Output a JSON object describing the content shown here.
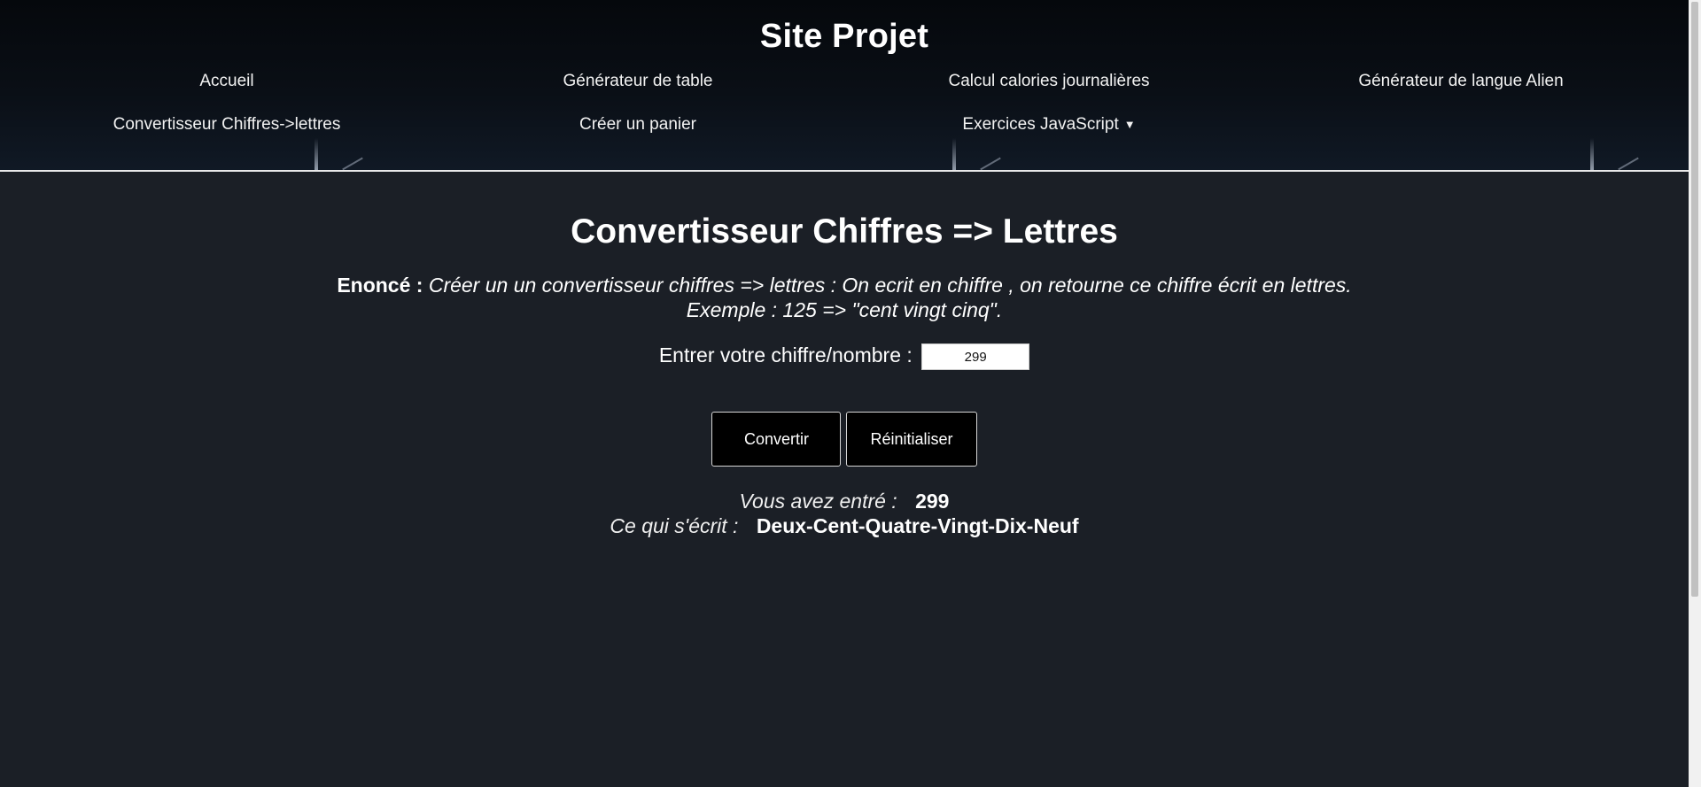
{
  "header": {
    "site_title": "Site Projet",
    "nav": [
      {
        "label": "Accueil"
      },
      {
        "label": "Générateur de table"
      },
      {
        "label": "Calcul calories journalières"
      },
      {
        "label": "Générateur de langue Alien"
      },
      {
        "label": "Convertisseur Chiffres->lettres"
      },
      {
        "label": "Créer un panier"
      },
      {
        "label": "Exercices JavaScript",
        "icon": "caret-down-icon",
        "caret": "▼"
      }
    ]
  },
  "main": {
    "title": "Convertisseur Chiffres => Lettres",
    "enonce_label": "Enoncé :",
    "enonce_text_line1": "Créer un un convertisseur chiffres => lettres : On ecrit en chiffre , on retourne ce chiffre écrit en lettres.",
    "enonce_text_line2": "Exemple : 125 => \"cent vingt cinq\".",
    "input_label": "Entrer votre chiffre/nombre :",
    "input_value": "299",
    "convert_label": "Convertir",
    "reset_label": "Réinitialiser",
    "result_entered_label": "Vous avez entré :",
    "result_entered_value": "299",
    "result_written_label": "Ce qui s'écrit :",
    "result_written_value": "Deux-Cent-Quatre-Vingt-Dix-Neuf"
  },
  "colors": {
    "header_bg": "#05080c",
    "page_bg": "#1b1f26",
    "button_bg": "#000000",
    "text": "#ffffff"
  }
}
